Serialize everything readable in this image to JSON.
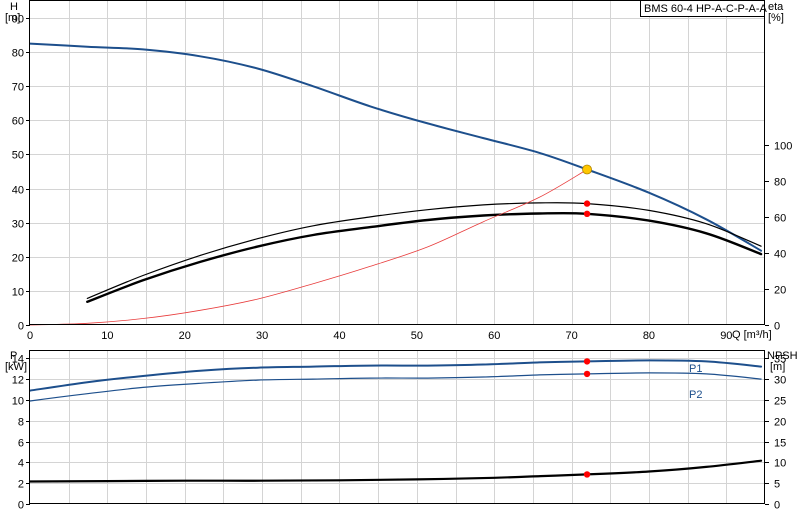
{
  "colors": {
    "blue": "#1d4f8c",
    "black": "#000000",
    "system_red": "#e83c3c",
    "dot_red": "#ff0000",
    "dot_yellow": "#ffc700",
    "grid": "#d4d4d4"
  },
  "chart_data": [
    {
      "id": "top",
      "type": "line",
      "title": "BMS 60-4 HP-A-C-P-A-A",
      "y_left_label": "H",
      "y_left_unit": "[m]",
      "y_right_label": "eta",
      "y_right_unit": "[%]",
      "x_label": "Q [m³/h]",
      "xlim": [
        0,
        95
      ],
      "ylim": [
        0,
        95
      ],
      "y2lim": [
        0,
        180
      ],
      "x_ticks": [
        0,
        10,
        20,
        30,
        40,
        50,
        60,
        70,
        80,
        90
      ],
      "y_ticks": [
        0,
        10,
        20,
        30,
        40,
        50,
        60,
        70,
        80,
        90
      ],
      "y2_ticks": [
        0,
        20,
        40,
        60,
        80,
        100
      ],
      "grid": true,
      "series": [
        {
          "axis": "left",
          "color": "blue",
          "width": 2,
          "x": [
            0,
            7.4,
            14.6,
            22,
            29.4,
            36.6,
            44,
            51.4,
            58.6,
            65.8,
            72,
            80,
            87.4,
            94.5
          ],
          "y": [
            82.5,
            81.6,
            80.8,
            78.8,
            75.2,
            70,
            64.1,
            59.1,
            54.8,
            50.5,
            45.6,
            38.8,
            31,
            21.8
          ]
        },
        {
          "axis": "left",
          "color": "black",
          "width": 1.2,
          "x": [
            7.4,
            14.6,
            22,
            29.4,
            36.6,
            44,
            51.4,
            58.6,
            65.8,
            72,
            80,
            87.4,
            94.5
          ],
          "y": [
            7.8,
            14.5,
            20.4,
            25.3,
            29.1,
            31.7,
            33.8,
            35.2,
            35.8,
            35.6,
            33.6,
            29.7,
            23.1
          ]
        },
        {
          "axis": "left",
          "color": "black",
          "width": 2.4,
          "x": [
            7.4,
            14.6,
            22,
            29.4,
            36.6,
            44,
            51.4,
            58.6,
            65.8,
            72,
            80,
            87.4,
            94.5
          ],
          "y": [
            6.8,
            13.1,
            18.5,
            23,
            26.4,
            28.7,
            30.8,
            32.1,
            32.7,
            32.6,
            30.6,
            26.9,
            20.8
          ]
        },
        {
          "axis": "left",
          "color": "system_red",
          "width": 0.8,
          "x": [
            0,
            7.4,
            14.6,
            22,
            29.4,
            36.6,
            44,
            51.4,
            58.6,
            65.8,
            72
          ],
          "y": [
            0,
            0.5,
            1.9,
            4.3,
            7.6,
            12.1,
            17.2,
            22.9,
            30.3,
            37.4,
            45.6
          ]
        }
      ],
      "markers": [
        {
          "axis": "left",
          "x": 72,
          "y": 45.6,
          "color": "dot_yellow",
          "r": 4.5
        },
        {
          "axis": "left",
          "x": 72,
          "y": 35.6,
          "color": "dot_red",
          "r": 3.2
        },
        {
          "axis": "left",
          "x": 72,
          "y": 32.6,
          "color": "dot_red",
          "r": 3.2
        }
      ]
    },
    {
      "id": "bottom",
      "type": "line",
      "y_left_label": "P",
      "y_left_unit": "[kW]",
      "y_right_label": "NPSH",
      "y_right_unit": "[m]",
      "xlim": [
        0,
        95
      ],
      "ylim": [
        0,
        14.7
      ],
      "y2lim": [
        0,
        36.75
      ],
      "y_ticks": [
        0,
        2,
        4,
        6,
        8,
        10,
        12,
        14
      ],
      "y2_ticks": [
        0,
        5,
        10,
        15,
        20,
        25,
        30,
        35
      ],
      "grid": true,
      "series": [
        {
          "axis": "left",
          "color": "blue",
          "width": 2,
          "label": "P1",
          "x": [
            0,
            7.4,
            14.6,
            22,
            29.4,
            36.6,
            44,
            51.4,
            58.6,
            65.8,
            72,
            80,
            87.4,
            94.5
          ],
          "y": [
            10.9,
            11.7,
            12.3,
            12.8,
            13.1,
            13.2,
            13.3,
            13.3,
            13.4,
            13.6,
            13.7,
            13.8,
            13.7,
            13.2
          ]
        },
        {
          "axis": "left",
          "color": "blue",
          "width": 1.2,
          "label": "P2",
          "x": [
            0,
            7.4,
            14.6,
            22,
            29.4,
            36.6,
            44,
            51.4,
            58.6,
            65.8,
            72,
            80,
            87.4,
            94.5
          ],
          "y": [
            9.9,
            10.6,
            11.2,
            11.6,
            11.9,
            12,
            12.1,
            12.1,
            12.2,
            12.4,
            12.5,
            12.6,
            12.5,
            12
          ]
        },
        {
          "axis": "right",
          "color": "black",
          "width": 2.2,
          "x": [
            0,
            10,
            20,
            30,
            40,
            50,
            60,
            66,
            72,
            80,
            87.4,
            94.5
          ],
          "y": [
            5.4,
            5.5,
            5.6,
            5.6,
            5.7,
            5.9,
            6.3,
            6.7,
            7.1,
            7.8,
            8.9,
            10.4
          ]
        }
      ],
      "markers": [
        {
          "axis": "left",
          "x": 72,
          "y": 13.7,
          "color": "dot_red",
          "r": 3.2
        },
        {
          "axis": "left",
          "x": 72,
          "y": 12.5,
          "color": "dot_red",
          "r": 3.2
        },
        {
          "axis": "right",
          "x": 72,
          "y": 7.1,
          "color": "dot_red",
          "r": 3.2
        }
      ]
    }
  ]
}
